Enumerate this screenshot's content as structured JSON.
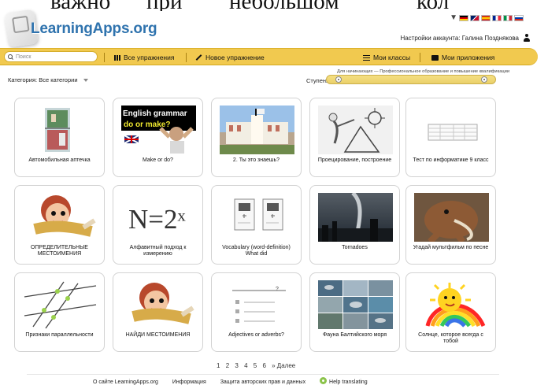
{
  "top_text": [
    "важно",
    "при",
    "небольшом",
    "кол"
  ],
  "top_flags": [
    "▼"
  ],
  "logo_text": "LearningApps.org",
  "account": "Настройки аккаунта: Галина Позднякова",
  "nav": {
    "search_placeholder": "Поиск",
    "items": [
      "Все упражнения",
      "Новое упражнение",
      "Мои классы",
      "Мои приложения"
    ]
  },
  "filters": {
    "category": "Категория: Все категории",
    "level_label": "Ступени:",
    "level_note": "Для начинающих — Профессиональное образование и повышение квалификации"
  },
  "cards": [
    "Автомобильная аптечка",
    "Make or do?",
    "2. Ты это знаешь?",
    "Проецирование, построение",
    "Тест по информатике 9 класс",
    "ОПРЕДЕЛИТЕЛЬНЫЕ МЕСТОИМЕНИЯ",
    "Алфавитный подход к измерению",
    "Vocabulary (word-definition) What did",
    "Tornadoes",
    "Угадай мультфильм по песне",
    "Признаки параллельности",
    "НАЙДИ МЕСТОИМЕНИЯ",
    "Adjectives or adverbs?",
    "Фауна Балтийского моря",
    "Солнце, которое всегда с тобой"
  ],
  "thumbs": {
    "english_grammar": "English grammar",
    "make_question": "do or make?",
    "math_formula": "N=2ˣ"
  },
  "pager": [
    "1",
    "2",
    "3",
    "4",
    "5",
    "6",
    "» Далее"
  ],
  "footer": [
    "О сайте LearningApps.org",
    "Информация",
    "Защита авторских прав и данных",
    "Help translating"
  ]
}
